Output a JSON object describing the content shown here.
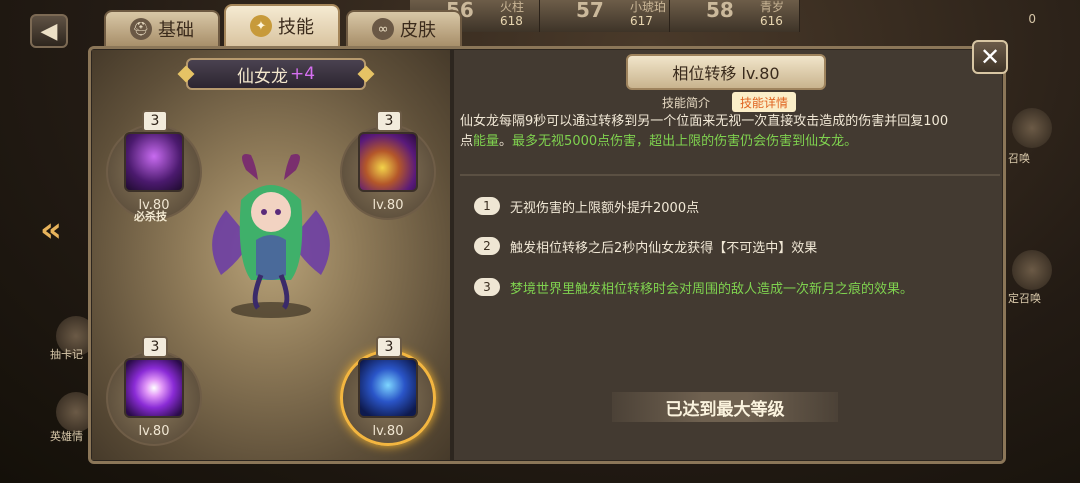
{
  "header": {
    "back_label": "◀",
    "right_counter": "0",
    "ranks": [
      {
        "rank": "56",
        "name": "火柱",
        "score": "618"
      },
      {
        "rank": "57",
        "name": "小琥珀",
        "score": "617"
      },
      {
        "rank": "58",
        "name": "青岁",
        "score": "616"
      }
    ]
  },
  "tabs": [
    {
      "label": "基础",
      "icon": "helmet-icon",
      "active": false
    },
    {
      "label": "技能",
      "icon": "skill-star-icon",
      "active": true
    },
    {
      "label": "皮肤",
      "icon": "skin-mask-icon",
      "active": false
    }
  ],
  "hero": {
    "name": "仙女龙",
    "plus": "+4"
  },
  "skills": [
    {
      "level_badge": "3",
      "lv": "lv.80",
      "icon": "purple-vine-icon",
      "tag": "必杀技"
    },
    {
      "level_badge": "3",
      "lv": "lv.80",
      "icon": "golden-coins-icon",
      "tag": ""
    },
    {
      "level_badge": "3",
      "lv": "lv.80",
      "icon": "purple-burst-icon",
      "tag": ""
    },
    {
      "level_badge": "3",
      "lv": "lv.80",
      "icon": "blue-spirit-icon",
      "tag": "",
      "selected": true
    }
  ],
  "detail": {
    "title": "相位转移 lv.80",
    "tab_intro": "技能简介",
    "tab_detail": "技能详情",
    "desc_line1": "仙女龙每隔9秒可以通过转移到另一个位面来无视一次直接攻击造成的伤害并回复100",
    "desc_line2_a": "点",
    "desc_line2_b": "能量",
    "desc_line2_c": "。",
    "desc_line2_d": "最多无视5000点伤害，超出上限的伤害仍会伤害到仙女龙。",
    "upgrades": [
      {
        "num": "1",
        "text": "无视伤害的上限额外提升2000点",
        "green": false
      },
      {
        "num": "2",
        "text": "触发相位转移之后2秒内仙女龙获得【不可选中】效果",
        "green": false
      },
      {
        "num": "3",
        "text": "梦境世界里触发相位转移时会对周围的敌人造成一次新月之痕的效果。",
        "green": true
      }
    ],
    "max_label": "已达到最大等级"
  },
  "side": {
    "left_labels": [
      "抽卡记",
      "英雄情"
    ],
    "right_labels": [
      "召唤",
      "定召唤"
    ]
  },
  "colors": {
    "accent": "#f1b230",
    "highlight_green": "#7fd24f",
    "detail_tab_text": "#e06420"
  }
}
